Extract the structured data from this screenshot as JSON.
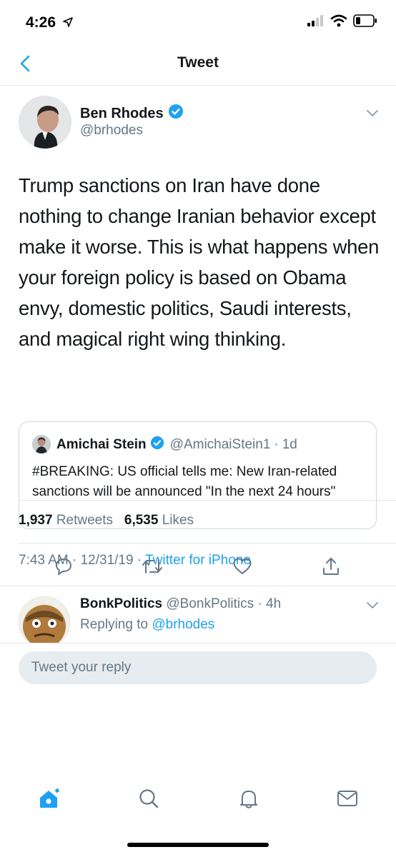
{
  "status_bar": {
    "time": "4:26"
  },
  "nav": {
    "title": "Tweet"
  },
  "tweet": {
    "author_name": "Ben Rhodes",
    "author_handle": "@brhodes",
    "text": "Trump sanctions on Iran have done nothing to change Iranian behavior except make it worse. This is what happens when your foreign policy is based on Obama envy, domestic politics, Saudi interests, and magical right wing thinking.",
    "quote": {
      "name": "Amichai Stein",
      "handle": "@AmichaiStein1",
      "separator": "·",
      "time": "1d",
      "text": "#BREAKING: US official tells me: New Iran-related sanctions will be announced \"In the next 24 hours\""
    },
    "meta": {
      "time": "7:43 AM",
      "sep1": " · ",
      "date": "12/31/19",
      "sep2": " · ",
      "source": "Twitter for iPhone"
    },
    "stats": {
      "retweets_count": "1,937",
      "retweets_label": "Retweets",
      "likes_count": "6,535",
      "likes_label": "Likes"
    }
  },
  "reply": {
    "name": "BonkPolitics",
    "handle": "@BonkPolitics",
    "separator": "·",
    "time": "4h",
    "replying_label": "Replying to",
    "replying_to": "@brhodes"
  },
  "compose": {
    "placeholder": "Tweet your reply"
  },
  "colors": {
    "accent": "#1da1f2",
    "text": "#14171a",
    "secondary": "#657786",
    "divider": "#e1e8ed"
  },
  "icons": {
    "status": [
      "location-arrow-icon",
      "signal-icon",
      "wifi-icon",
      "battery-icon"
    ],
    "actions": [
      "reply-icon",
      "retweet-icon",
      "like-icon",
      "share-icon"
    ],
    "tabs": [
      "home-icon",
      "search-icon",
      "notifications-icon",
      "messages-icon"
    ]
  }
}
